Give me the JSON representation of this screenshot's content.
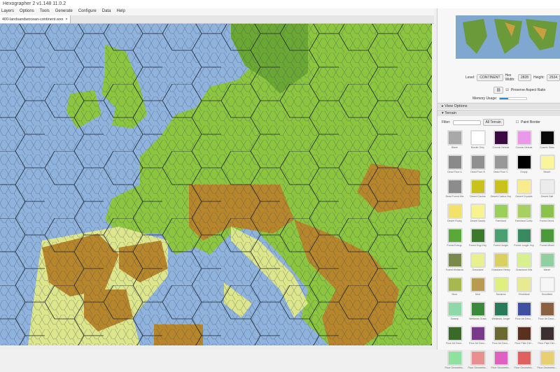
{
  "window": {
    "title": "Hexographer 2 v1.148 11.0.2"
  },
  "menu": [
    "Layers",
    "Options",
    "Tools",
    "Generate",
    "Configure",
    "Data",
    "Help"
  ],
  "tab": {
    "label": "400-landsandwocean-continent.wxx",
    "close": "×"
  },
  "panel": {
    "level_label": "Level:",
    "level_value": "CONTINENT",
    "hex_width_label": "Hex Width:",
    "hex_width": "2828",
    "height_label": "Height:",
    "height": "2534",
    "preserve_aspect": "Preserve Aspect Ratio",
    "preserve_checked": true,
    "memory_label": "Memory Usage:",
    "memory_fraction": 0.3,
    "view_options": "View Options",
    "terrain": "Terrain",
    "filter_label": "Filter:",
    "filter_value": "",
    "filter_select": "All Terrain",
    "paint_border": "Paint Border"
  },
  "terrain": [
    {
      "name": "Blank",
      "color": "#a8a8a8"
    },
    {
      "name": "Border Only",
      "color": "#ffffff"
    },
    {
      "name": "Cosmic Nebula",
      "color": "#3a0a40"
    },
    {
      "name": "Cosmic Nebula",
      "color": "#e89ae8"
    },
    {
      "name": "Cosmic Stars",
      "color": "#080808"
    },
    {
      "name": "Dead Floor A",
      "color": "#8a8a8a"
    },
    {
      "name": "Dead Floor B",
      "color": "#909090"
    },
    {
      "name": "Dead Floor C",
      "color": "#989898"
    },
    {
      "name": "Empty",
      "color": "#000000"
    },
    {
      "name": "Beach",
      "color": "#fbf59a"
    },
    {
      "name": "Dead Forest Mix",
      "color": "#8c8c8c"
    },
    {
      "name": "Desert Cactus",
      "color": "#c9c21a"
    },
    {
      "name": "Desert Cactus Hvy",
      "color": "#c9c21a"
    },
    {
      "name": "Desert Crystals",
      "color": "#f8ec8e"
    },
    {
      "name": "Desert Salt",
      "color": "#ececec"
    },
    {
      "name": "Desert Rocky",
      "color": "#f3e26a"
    },
    {
      "name": "Desert Sandy",
      "color": "#f8f290"
    },
    {
      "name": "Farmland",
      "color": "#9acf5a"
    },
    {
      "name": "Farmland Cultiv.",
      "color": "#a8d060"
    },
    {
      "name": "Forest Decid.",
      "color": "#8ac24a"
    },
    {
      "name": "Forest Evergr.",
      "color": "#5aa83a"
    },
    {
      "name": "Forest Evgr Hvy",
      "color": "#3a7a2a"
    },
    {
      "name": "Forest Jungle",
      "color": "#4aa070"
    },
    {
      "name": "Forest Jungle Hvy",
      "color": "#3a8a60"
    },
    {
      "name": "Forest Mixed",
      "color": "#4a9a3a"
    },
    {
      "name": "Forest Wetlands",
      "color": "#7a8a4a"
    },
    {
      "name": "Grassland",
      "color": "#e8f090"
    },
    {
      "name": "Grassland Heavy",
      "color": "#d8d060"
    },
    {
      "name": "Grassland Hills",
      "color": "#d8f090"
    },
    {
      "name": "Marsh",
      "color": "#90d0a0"
    },
    {
      "name": "Moor",
      "color": "#a8b850"
    },
    {
      "name": "Mud",
      "color": "#b89a50"
    },
    {
      "name": "Savanna",
      "color": "#e0f080"
    },
    {
      "name": "Shrubland",
      "color": "#e8ea90"
    },
    {
      "name": "Snowfield",
      "color": "#f6f6f6"
    },
    {
      "name": "Swamp",
      "color": "#90d8a8"
    },
    {
      "name": "Wetlands Grass",
      "color": "#3a8a3a"
    },
    {
      "name": "Wetlands Jungle",
      "color": "#2a7a5a"
    },
    {
      "name": "Floor Art Deco...",
      "color": "#4050a0"
    },
    {
      "name": "Floor Art Deco...",
      "color": "#8a6040"
    },
    {
      "name": "Floor Art Deco...",
      "color": "#3a6a2a"
    },
    {
      "name": "Floor Art Deco...",
      "color": "#7a3a8a"
    },
    {
      "name": "Floor Art Deco...",
      "color": "#6a6a30"
    },
    {
      "name": "Floor Plain Dirt...",
      "color": "#5a3020"
    },
    {
      "name": "Floor Plain Dirt...",
      "color": "#3a3030"
    },
    {
      "name": "Floor Geometric...",
      "color": "#90e0a0"
    },
    {
      "name": "Floor Geometric...",
      "color": "#e89090"
    },
    {
      "name": "Floor Geometric...",
      "color": "#e060c0"
    },
    {
      "name": "Floor Geometric...",
      "color": "#e06060"
    },
    {
      "name": "Floor Geometric...",
      "color": "#e8d070"
    }
  ],
  "colors": {
    "ocean": "#8fb3dc",
    "lowland": "#8cc63f",
    "forest": "#6aa833",
    "mountain": "#b8862a",
    "plains": "#dde68a"
  }
}
